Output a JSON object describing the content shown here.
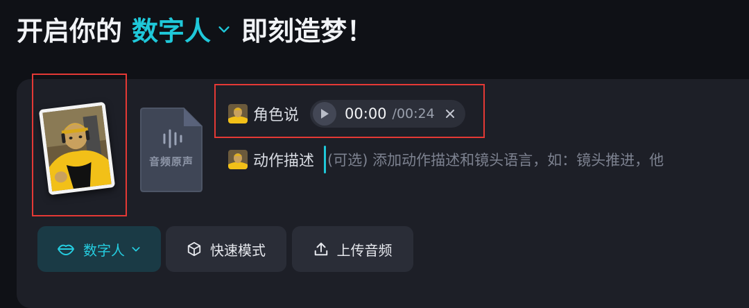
{
  "header": {
    "title_prefix": "开启你的",
    "title_accent": "数字人",
    "title_suffix": "即刻造梦！"
  },
  "media": {
    "file_card_label": "音频原声"
  },
  "dialog_row": {
    "label": "角色说",
    "audio": {
      "current_time": "00:00",
      "total_time": "/00:24"
    }
  },
  "action_row": {
    "label": "动作描述",
    "placeholder": "(可选) 添加动作描述和镜头语言，如：镜头推进，他"
  },
  "toolbar": {
    "mode_label": "数字人",
    "fast_mode_label": "快速模式",
    "upload_label": "上传音频"
  },
  "colors": {
    "accent": "#1fc8d9",
    "highlight_box": "#e53935",
    "panel_bg": "#1d1f27",
    "page_bg": "#0f1116"
  }
}
